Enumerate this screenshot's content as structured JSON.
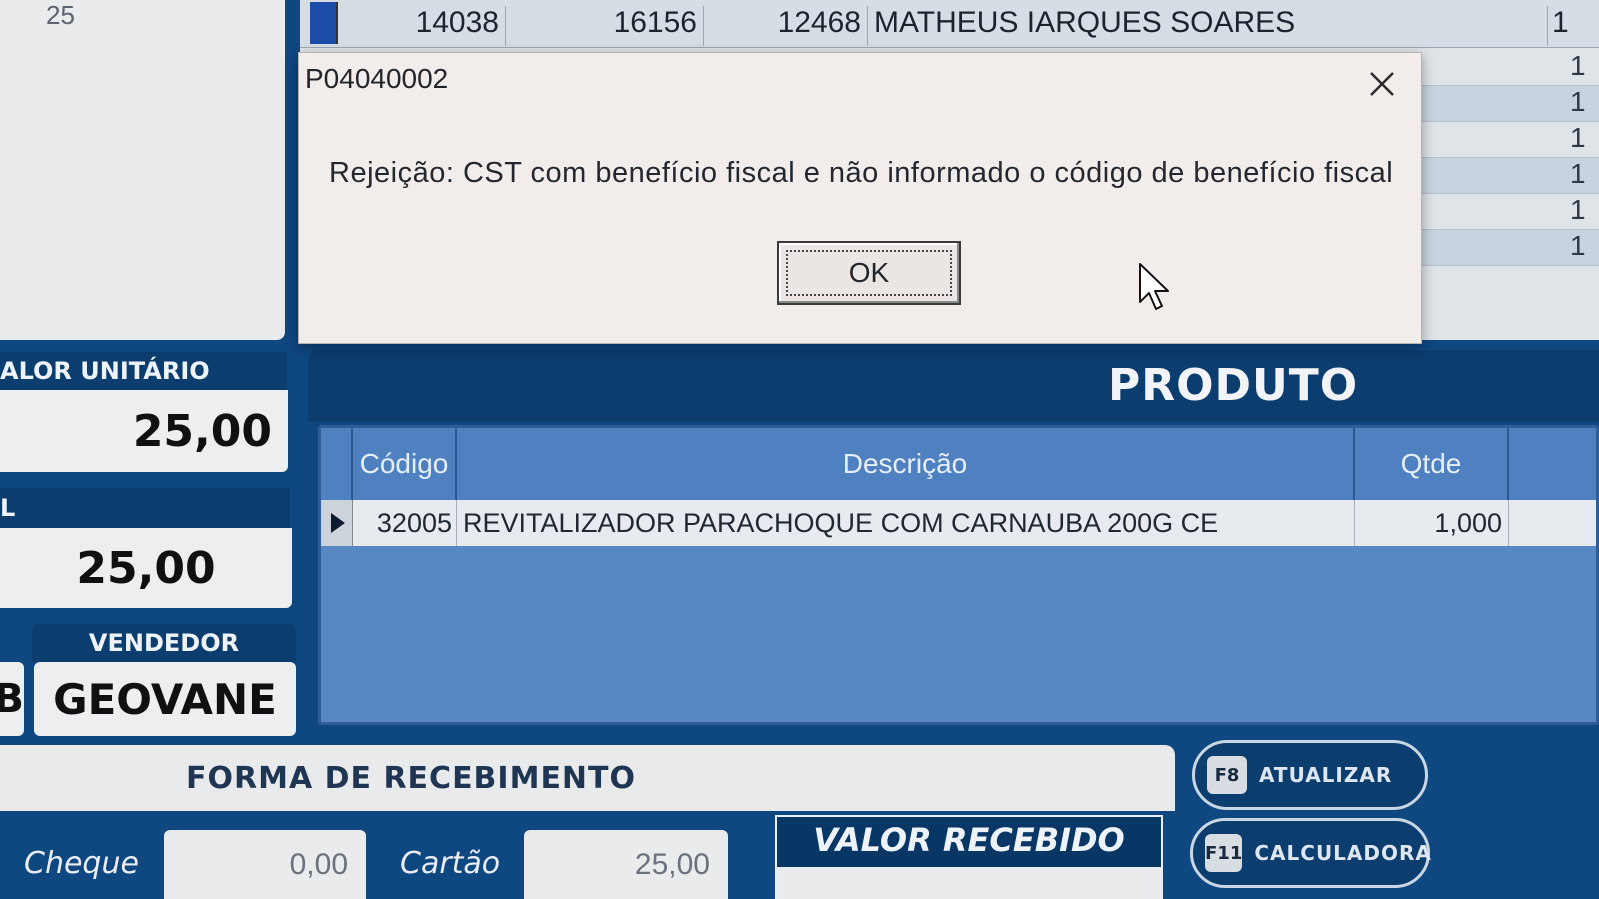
{
  "left_panel": {
    "qty_top": "25",
    "valor_unitario_label": "ALOR UNITÁRIO",
    "valor_unitario": "25,00",
    "total_label": "L",
    "total": "25,00",
    "vendedor_prefix": "B",
    "vendedor_label": "VENDEDOR",
    "vendedor": "GEOVANE"
  },
  "bg_grid": {
    "row": [
      "14038",
      "16156",
      "12468",
      "MATHEUS IARQUES SOARES"
    ],
    "right_digits": [
      "1",
      "1",
      "1",
      "1",
      "1",
      "1",
      "1"
    ]
  },
  "dialog": {
    "title": "P04040002",
    "message": "Rejeição: CST com benefício fiscal e não informado o código de benefício fiscal",
    "ok_label": "OK"
  },
  "produto": {
    "title": "PRODUTO",
    "columns": [
      "Código",
      "Descrição",
      "Qtde"
    ],
    "rows": [
      {
        "codigo": "32005",
        "descricao": "REVITALIZADOR PARACHOQUE COM CARNAUBA 200G CE",
        "qtde": "1,000"
      }
    ]
  },
  "recebimento": {
    "title": "FORMA DE RECEBIMENTO",
    "cheque_label": "Cheque",
    "cheque_value": "0,00",
    "cartao_label": "Cartão",
    "cartao_value": "25,00",
    "valor_recebido_label": "VALOR RECEBIDO"
  },
  "function_keys": [
    {
      "key": "F8",
      "label": "ATUALIZAR"
    },
    {
      "key": "F11",
      "label": "CALCULADORA"
    }
  ],
  "colors": {
    "background_blue": "#0f4781",
    "header_blue": "#0c3d6f",
    "table_blue": "#5888c4",
    "dialog_bg": "#f2ecea"
  }
}
